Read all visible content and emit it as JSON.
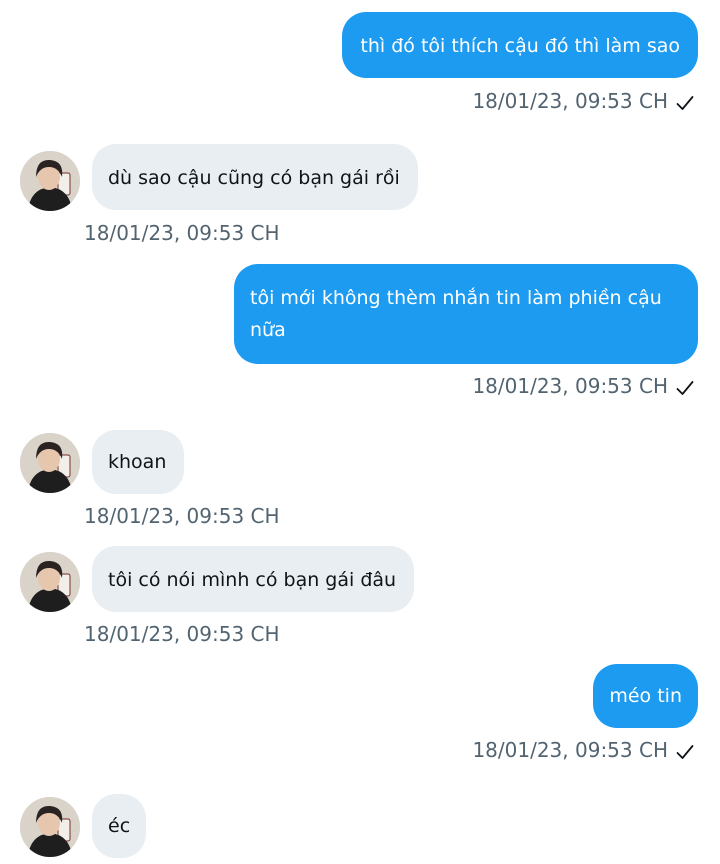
{
  "messages": [
    {
      "dir": "out",
      "text": "thì đó tôi thích cậu đó thì làm sao",
      "time": "18/01/23,  09:53 CH"
    },
    {
      "dir": "in",
      "text": "dù sao cậu cũng có bạn gái rồi",
      "time": "18/01/23,  09:53 CH"
    },
    {
      "dir": "out",
      "text": "tôi mới không thèm nhắn tin làm phiền cậu nữa",
      "time": "18/01/23,  09:53 CH"
    },
    {
      "dir": "in",
      "text": "khoan",
      "time": "18/01/23,  09:53 CH"
    },
    {
      "dir": "in",
      "text": "tôi có nói mình có bạn gái đâu",
      "time": "18/01/23,  09:53 CH"
    },
    {
      "dir": "out",
      "text": "méo tin",
      "time": "18/01/23,  09:53 CH"
    },
    {
      "dir": "in",
      "text": "éc",
      "time": ""
    }
  ],
  "colors": {
    "outgoing_bubble": "#1d9bf0",
    "incoming_bubble": "#e9eef2",
    "timestamp": "#536471"
  },
  "icons": {
    "sent_status": "checkmark-icon",
    "contact_avatar": "avatar"
  }
}
